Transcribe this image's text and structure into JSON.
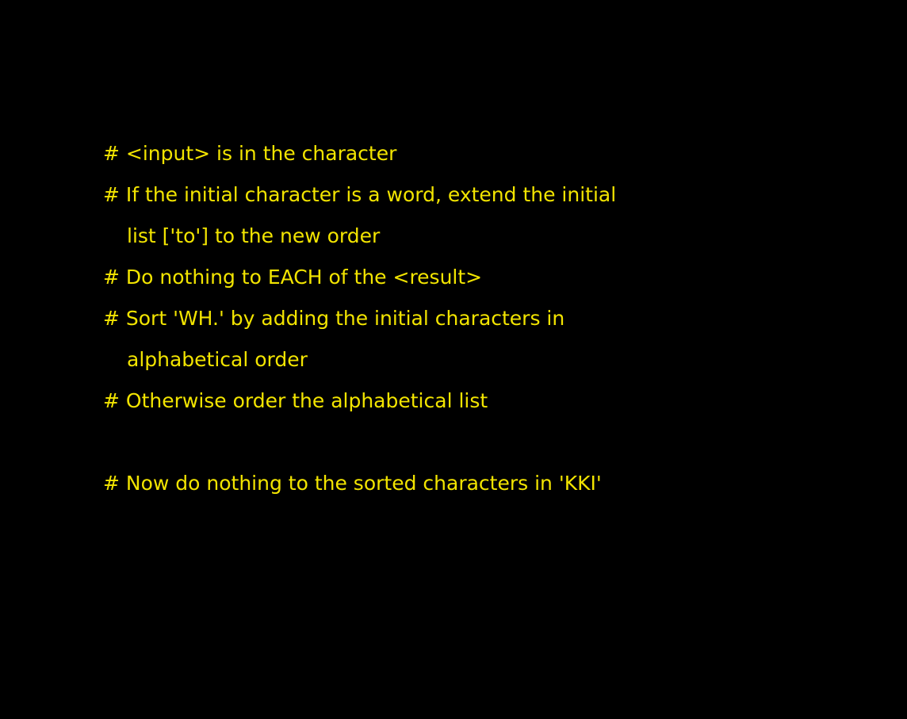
{
  "lines": [
    "# <input> is in the character",
    "# If the initial character is a word, extend the initial",
    "list ['to'] to the new order",
    "# Do nothing to EACH of the <result>",
    "# Sort 'WH.' by adding the initial characters in",
    "alphabetical order",
    "# Otherwise order the alphabetical list",
    "",
    "# Now do nothing to the sorted characters in 'KKI'"
  ],
  "colors": {
    "background": "#000000",
    "text": "#f2e400"
  }
}
